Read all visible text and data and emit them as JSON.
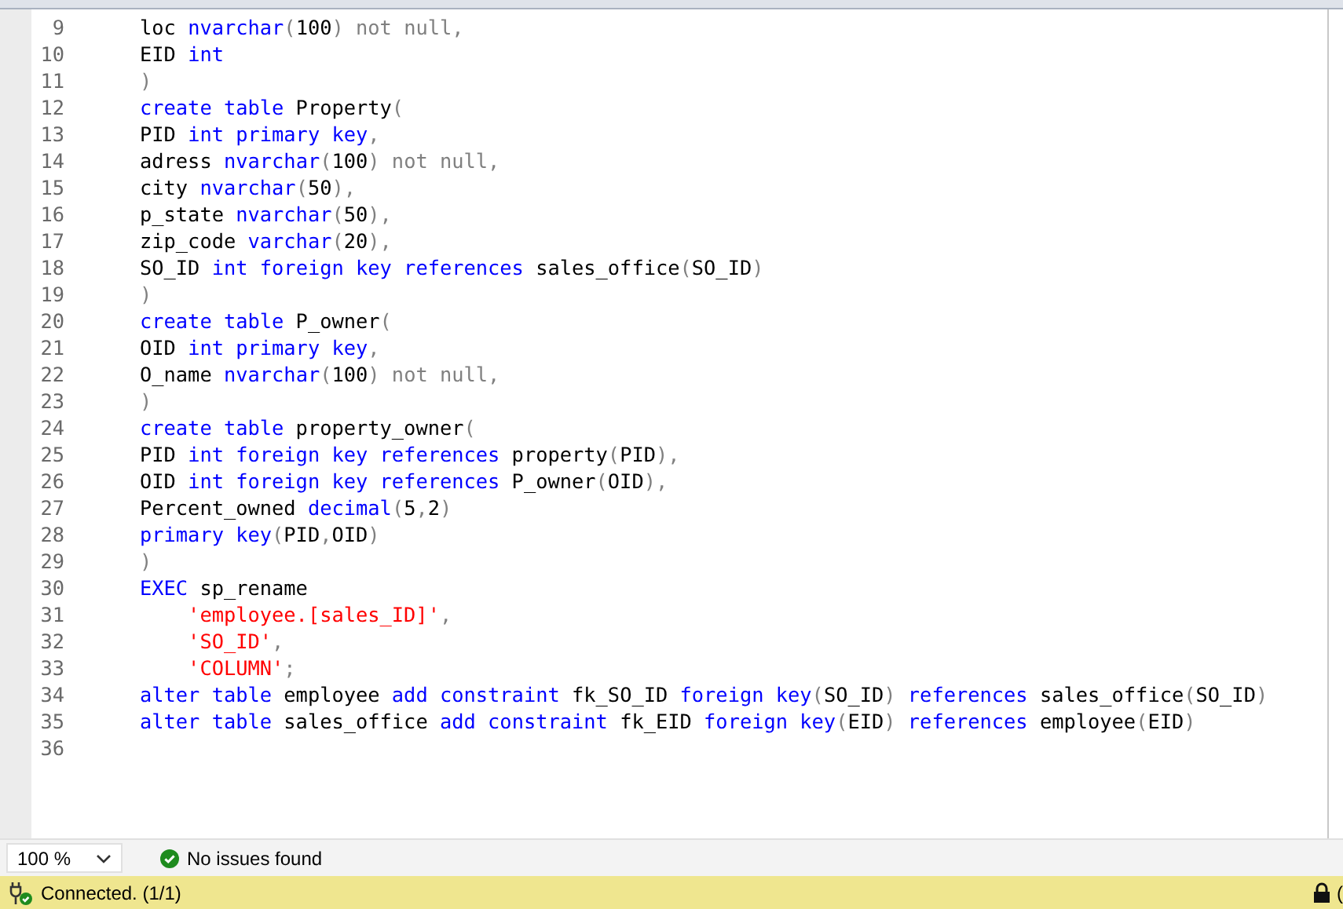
{
  "editor": {
    "lines": [
      {
        "number": "9",
        "tokens": [
          {
            "kind": "id",
            "text": "loc "
          },
          {
            "kind": "kw",
            "text": "nvarchar"
          },
          {
            "kind": "op",
            "text": "("
          },
          {
            "kind": "id",
            "text": "100"
          },
          {
            "kind": "op",
            "text": ") not null,"
          }
        ]
      },
      {
        "number": "10",
        "tokens": [
          {
            "kind": "id",
            "text": "EID "
          },
          {
            "kind": "kw",
            "text": "int"
          }
        ]
      },
      {
        "number": "11",
        "tokens": [
          {
            "kind": "op",
            "text": ")"
          }
        ]
      },
      {
        "number": "12",
        "tokens": [
          {
            "kind": "kw",
            "text": "create table"
          },
          {
            "kind": "id",
            "text": " Property"
          },
          {
            "kind": "op",
            "text": "("
          }
        ]
      },
      {
        "number": "13",
        "tokens": [
          {
            "kind": "id",
            "text": "PID "
          },
          {
            "kind": "kw",
            "text": "int primary key"
          },
          {
            "kind": "op",
            "text": ","
          }
        ]
      },
      {
        "number": "14",
        "tokens": [
          {
            "kind": "id",
            "text": "adress "
          },
          {
            "kind": "kw",
            "text": "nvarchar"
          },
          {
            "kind": "op",
            "text": "("
          },
          {
            "kind": "id",
            "text": "100"
          },
          {
            "kind": "op",
            "text": ") not null,"
          }
        ]
      },
      {
        "number": "15",
        "tokens": [
          {
            "kind": "id",
            "text": "city "
          },
          {
            "kind": "kw",
            "text": "nvarchar"
          },
          {
            "kind": "op",
            "text": "("
          },
          {
            "kind": "id",
            "text": "50"
          },
          {
            "kind": "op",
            "text": "),"
          }
        ]
      },
      {
        "number": "16",
        "tokens": [
          {
            "kind": "id",
            "text": "p_state "
          },
          {
            "kind": "kw",
            "text": "nvarchar"
          },
          {
            "kind": "op",
            "text": "("
          },
          {
            "kind": "id",
            "text": "50"
          },
          {
            "kind": "op",
            "text": "),"
          }
        ]
      },
      {
        "number": "17",
        "tokens": [
          {
            "kind": "id",
            "text": "zip_code "
          },
          {
            "kind": "kw",
            "text": "varchar"
          },
          {
            "kind": "op",
            "text": "("
          },
          {
            "kind": "id",
            "text": "20"
          },
          {
            "kind": "op",
            "text": "),"
          }
        ]
      },
      {
        "number": "18",
        "tokens": [
          {
            "kind": "id",
            "text": "SO_ID "
          },
          {
            "kind": "kw",
            "text": "int foreign key references"
          },
          {
            "kind": "id",
            "text": " sales_office"
          },
          {
            "kind": "op",
            "text": "("
          },
          {
            "kind": "id",
            "text": "SO_ID"
          },
          {
            "kind": "op",
            "text": ")"
          }
        ]
      },
      {
        "number": "19",
        "tokens": [
          {
            "kind": "op",
            "text": ")"
          }
        ]
      },
      {
        "number": "20",
        "tokens": [
          {
            "kind": "kw",
            "text": "create table"
          },
          {
            "kind": "id",
            "text": " P_owner"
          },
          {
            "kind": "op",
            "text": "("
          }
        ]
      },
      {
        "number": "21",
        "tokens": [
          {
            "kind": "id",
            "text": "OID "
          },
          {
            "kind": "kw",
            "text": "int primary key"
          },
          {
            "kind": "op",
            "text": ","
          }
        ]
      },
      {
        "number": "22",
        "tokens": [
          {
            "kind": "id",
            "text": "O_name "
          },
          {
            "kind": "kw",
            "text": "nvarchar"
          },
          {
            "kind": "op",
            "text": "("
          },
          {
            "kind": "id",
            "text": "100"
          },
          {
            "kind": "op",
            "text": ") not null,"
          }
        ]
      },
      {
        "number": "23",
        "tokens": [
          {
            "kind": "op",
            "text": ")"
          }
        ]
      },
      {
        "number": "24",
        "tokens": [
          {
            "kind": "kw",
            "text": "create table"
          },
          {
            "kind": "id",
            "text": " property_owner"
          },
          {
            "kind": "op",
            "text": "("
          }
        ]
      },
      {
        "number": "25",
        "tokens": [
          {
            "kind": "id",
            "text": "PID "
          },
          {
            "kind": "kw",
            "text": "int foreign key references"
          },
          {
            "kind": "id",
            "text": " property"
          },
          {
            "kind": "op",
            "text": "("
          },
          {
            "kind": "id",
            "text": "PID"
          },
          {
            "kind": "op",
            "text": "),"
          }
        ]
      },
      {
        "number": "26",
        "tokens": [
          {
            "kind": "id",
            "text": "OID "
          },
          {
            "kind": "kw",
            "text": "int foreign key references"
          },
          {
            "kind": "id",
            "text": " P_owner"
          },
          {
            "kind": "op",
            "text": "("
          },
          {
            "kind": "id",
            "text": "OID"
          },
          {
            "kind": "op",
            "text": "),"
          }
        ]
      },
      {
        "number": "27",
        "tokens": [
          {
            "kind": "id",
            "text": "Percent_owned "
          },
          {
            "kind": "kw",
            "text": "decimal"
          },
          {
            "kind": "op",
            "text": "("
          },
          {
            "kind": "id",
            "text": "5"
          },
          {
            "kind": "op",
            "text": ","
          },
          {
            "kind": "id",
            "text": "2"
          },
          {
            "kind": "op",
            "text": ")"
          }
        ]
      },
      {
        "number": "28",
        "tokens": [
          {
            "kind": "kw",
            "text": "primary key"
          },
          {
            "kind": "op",
            "text": "("
          },
          {
            "kind": "id",
            "text": "PID"
          },
          {
            "kind": "op",
            "text": ","
          },
          {
            "kind": "id",
            "text": "OID"
          },
          {
            "kind": "op",
            "text": ")"
          }
        ]
      },
      {
        "number": "29",
        "tokens": [
          {
            "kind": "op",
            "text": ")"
          }
        ]
      },
      {
        "number": "30",
        "tokens": [
          {
            "kind": "kw",
            "text": "EXEC"
          },
          {
            "kind": "id",
            "text": " sp_rename"
          }
        ]
      },
      {
        "number": "31",
        "tokens": [
          {
            "kind": "str",
            "text": "    'employee.[sales_ID]'"
          },
          {
            "kind": "op",
            "text": ","
          }
        ]
      },
      {
        "number": "32",
        "tokens": [
          {
            "kind": "str",
            "text": "    'SO_ID'"
          },
          {
            "kind": "op",
            "text": ","
          }
        ]
      },
      {
        "number": "33",
        "tokens": [
          {
            "kind": "str",
            "text": "    'COLUMN'"
          },
          {
            "kind": "op",
            "text": ";"
          }
        ]
      },
      {
        "number": "34",
        "tokens": [
          {
            "kind": "kw",
            "text": "alter table"
          },
          {
            "kind": "id",
            "text": " employee "
          },
          {
            "kind": "kw",
            "text": "add constraint"
          },
          {
            "kind": "id",
            "text": " fk_SO_ID "
          },
          {
            "kind": "kw",
            "text": "foreign key"
          },
          {
            "kind": "op",
            "text": "("
          },
          {
            "kind": "id",
            "text": "SO_ID"
          },
          {
            "kind": "op",
            "text": ")"
          },
          {
            "kind": "kw",
            "text": " references"
          },
          {
            "kind": "id",
            "text": " sales_office"
          },
          {
            "kind": "op",
            "text": "("
          },
          {
            "kind": "id",
            "text": "SO_ID"
          },
          {
            "kind": "op",
            "text": ")"
          }
        ]
      },
      {
        "number": "35",
        "tokens": [
          {
            "kind": "kw",
            "text": "alter table"
          },
          {
            "kind": "id",
            "text": " sales_office "
          },
          {
            "kind": "kw",
            "text": "add constraint"
          },
          {
            "kind": "id",
            "text": " fk_EID "
          },
          {
            "kind": "kw",
            "text": "foreign key"
          },
          {
            "kind": "op",
            "text": "("
          },
          {
            "kind": "id",
            "text": "EID"
          },
          {
            "kind": "op",
            "text": ")"
          },
          {
            "kind": "kw",
            "text": " references"
          },
          {
            "kind": "id",
            "text": " employee"
          },
          {
            "kind": "op",
            "text": "("
          },
          {
            "kind": "id",
            "text": "EID"
          },
          {
            "kind": "op",
            "text": ")"
          }
        ]
      },
      {
        "number": "36"
      }
    ]
  },
  "editor_footer": {
    "zoom": "100 %",
    "issues": "No issues found"
  },
  "status_bar": {
    "connection": "Connected. (1/1)",
    "right_text": "("
  }
}
